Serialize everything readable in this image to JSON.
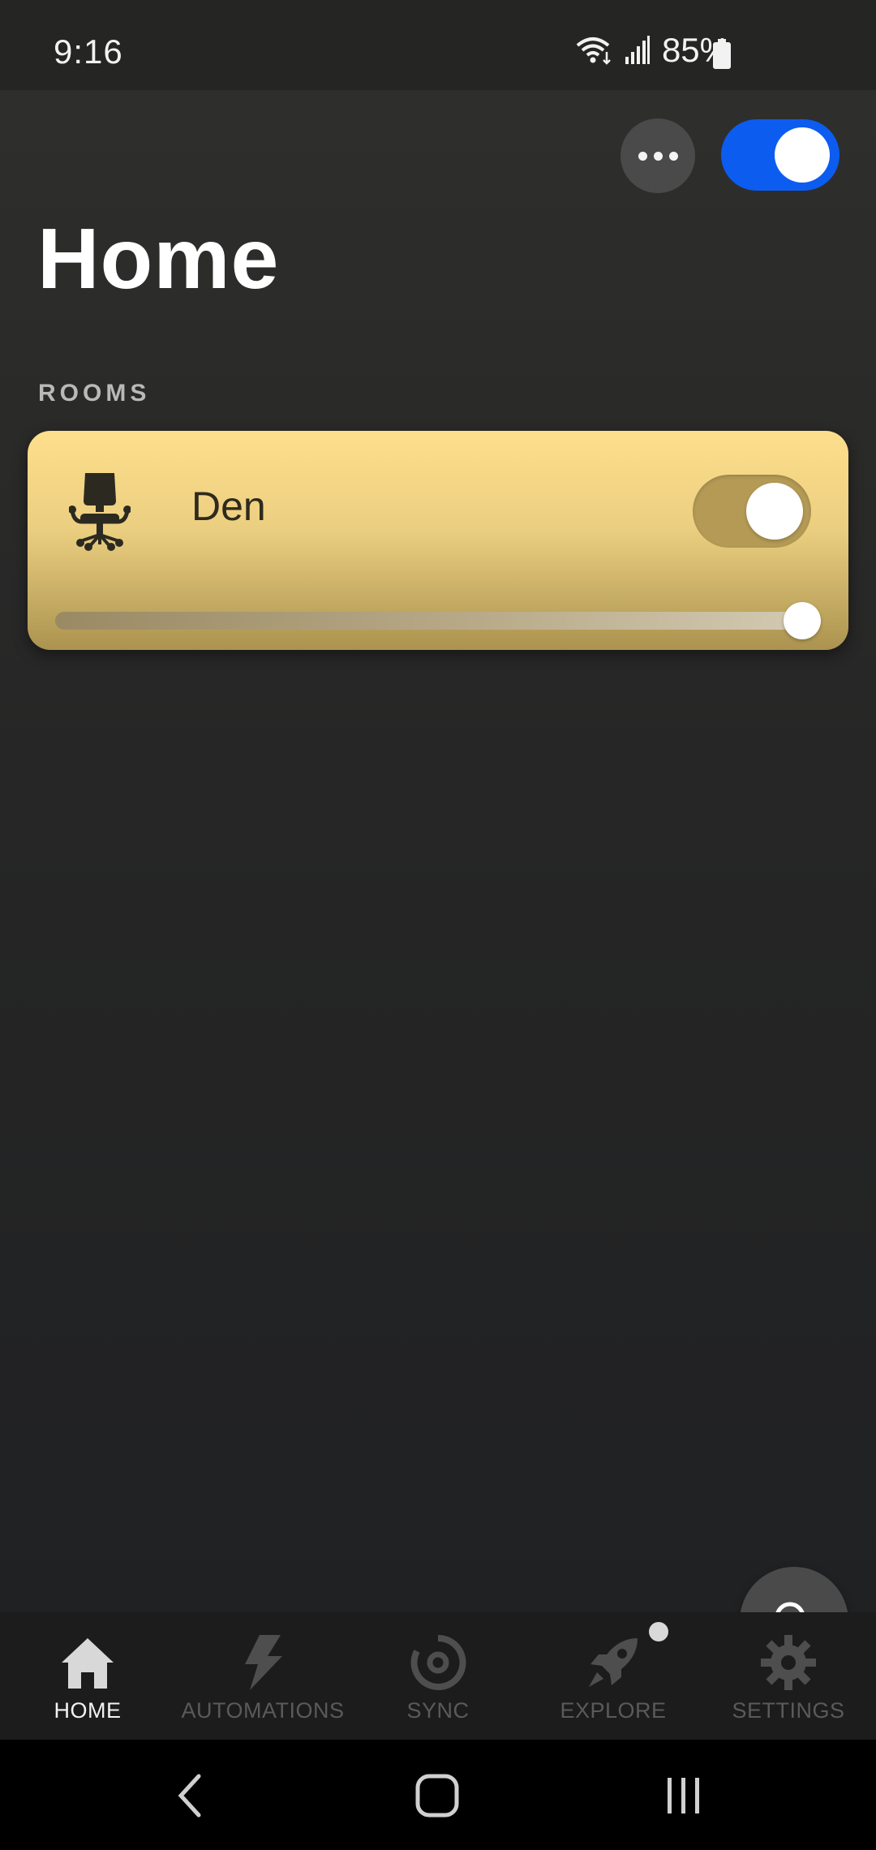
{
  "status_bar": {
    "time": "9:16",
    "battery": "85%"
  },
  "header": {
    "title": "Home",
    "more_icon": "more-horizontal-icon",
    "master_toggle_on": true
  },
  "rooms": {
    "section_label": "ROOMS",
    "items": [
      {
        "name": "Den",
        "icon": "office-chair-icon",
        "on": true,
        "brightness_percent": 100
      }
    ]
  },
  "fab": {
    "icon": "search-icon"
  },
  "bottom_nav": {
    "items": [
      {
        "label": "HOME",
        "icon": "home-icon",
        "active": true
      },
      {
        "label": "AUTOMATIONS",
        "icon": "lightning-icon",
        "active": false
      },
      {
        "label": "SYNC",
        "icon": "sync-icon",
        "active": false
      },
      {
        "label": "EXPLORE",
        "icon": "rocket-icon",
        "active": false,
        "badge": true
      },
      {
        "label": "SETTINGS",
        "icon": "gear-icon",
        "active": false
      }
    ]
  },
  "colors": {
    "accent": "#0c5cf0",
    "card_top": "#fddf8c",
    "card_bottom": "#ab9350"
  }
}
